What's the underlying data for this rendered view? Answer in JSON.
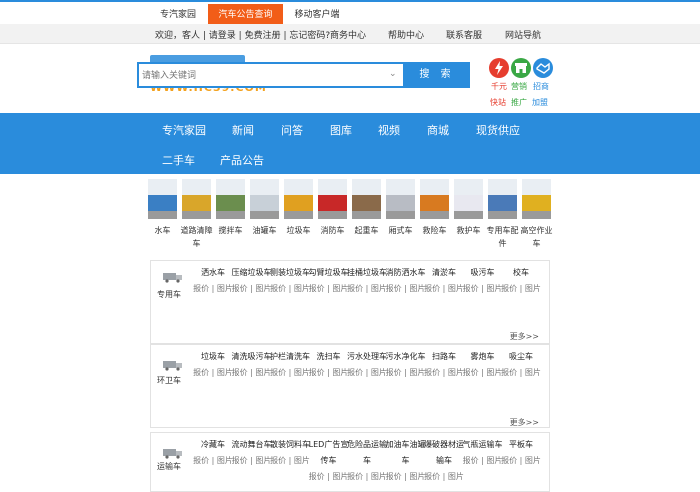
{
  "topbar": {
    "tabs": [
      {
        "label": "专汽家园",
        "active": false
      },
      {
        "label": "汽车公告查询",
        "active": true
      },
      {
        "label": "移动客户端",
        "active": false
      }
    ]
  },
  "loginrow": {
    "welcome": "欢迎，客人",
    "login": "请登录",
    "register": "免费注册",
    "forgot": "忘记密码?",
    "links": [
      "商务中心",
      "帮助中心",
      "联系客服",
      "网站导航"
    ]
  },
  "header": {
    "logo_url_text": "WWW.HC39.COM",
    "search_placeholder": "请输入关键词",
    "search_button": "搜 索",
    "quick": [
      {
        "icon": "lightning-icon",
        "top": "千元",
        "bottom": "快站",
        "color": "#e63d2e"
      },
      {
        "icon": "shop-icon",
        "top": "营销",
        "bottom": "推广",
        "color": "#3aa845"
      },
      {
        "icon": "handshake-icon",
        "top": "招商",
        "bottom": "加盟",
        "color": "#2a8cdc"
      }
    ]
  },
  "nav": {
    "row1": [
      "专汽家园",
      "新闻",
      "问答",
      "图库",
      "视频",
      "商城",
      "现货供应"
    ],
    "row2": [
      "二手车",
      "产品公告"
    ]
  },
  "thumbs": [
    {
      "label": "水车",
      "color": "#3a7fc4"
    },
    {
      "label": "道路清障车",
      "color": "#d9a62a"
    },
    {
      "label": "搅拌车",
      "color": "#6b8e4e"
    },
    {
      "label": "油罐车",
      "color": "#c8d0d8"
    },
    {
      "label": "垃圾车",
      "color": "#e0a020"
    },
    {
      "label": "消防车",
      "color": "#c82828"
    },
    {
      "label": "起重车",
      "color": "#8a6a4a"
    },
    {
      "label": "厢式车",
      "color": "#b8bcc4"
    },
    {
      "label": "救险车",
      "color": "#d87a20"
    },
    {
      "label": "救护车",
      "color": "#e8e8f0"
    },
    {
      "label": "专用车配件",
      "color": "#4a7ab8"
    },
    {
      "label": "高空作业车",
      "color": "#e0b020"
    }
  ],
  "categories": [
    {
      "name": "专用车",
      "more": "更多>>",
      "items": [
        [
          "洒水车",
          "报价 | 图片"
        ],
        [
          "压缩垃圾车",
          "报价 | 图片"
        ],
        [
          "侧装垃圾车",
          "报价 | 图片"
        ],
        [
          "勾臂垃圾车",
          "报价 | 图片"
        ],
        [
          "挂桶垃圾车",
          "报价 | 图片"
        ],
        [
          "消防洒水车",
          "报价 | 图片"
        ],
        [
          "清淤车",
          "报价 | 图片"
        ],
        [
          "吸污车",
          "报价 | 图片"
        ],
        [
          "校车",
          "报价 | 图片"
        ]
      ]
    },
    {
      "name": "环卫车",
      "more": "更多>>",
      "items": [
        [
          "垃圾车",
          "报价 | 图片"
        ],
        [
          "清洗吸污车",
          "报价 | 图片"
        ],
        [
          "护栏清洗车",
          "报价 | 图片"
        ],
        [
          "洗扫车",
          "报价 | 图片"
        ],
        [
          "污水处理车",
          "报价 | 图片"
        ],
        [
          "污水净化车",
          "报价 | 图片"
        ],
        [
          "扫路车",
          "报价 | 图片"
        ],
        [
          "雾炮车",
          "报价 | 图片"
        ],
        [
          "吸尘车",
          "报价 | 图片"
        ]
      ]
    },
    {
      "name": "运输车",
      "more": "",
      "items": [
        [
          "冷藏车",
          "报价 | 图片"
        ],
        [
          "流动舞台车",
          "报价 | 图片"
        ],
        [
          "散装饲料车",
          "报价 | 图片"
        ],
        [
          "LED广告宣传车",
          "报价 | 图片"
        ],
        [
          "危险品运输车",
          "报价 | 图片"
        ],
        [
          "加油车油罐车",
          "报价 | 图片"
        ],
        [
          "爆破器材运输车",
          "报价 | 图片"
        ],
        [
          "气瓶运输车",
          "报价 | 图片"
        ],
        [
          "平板车",
          "报价 | 图片"
        ]
      ]
    }
  ]
}
